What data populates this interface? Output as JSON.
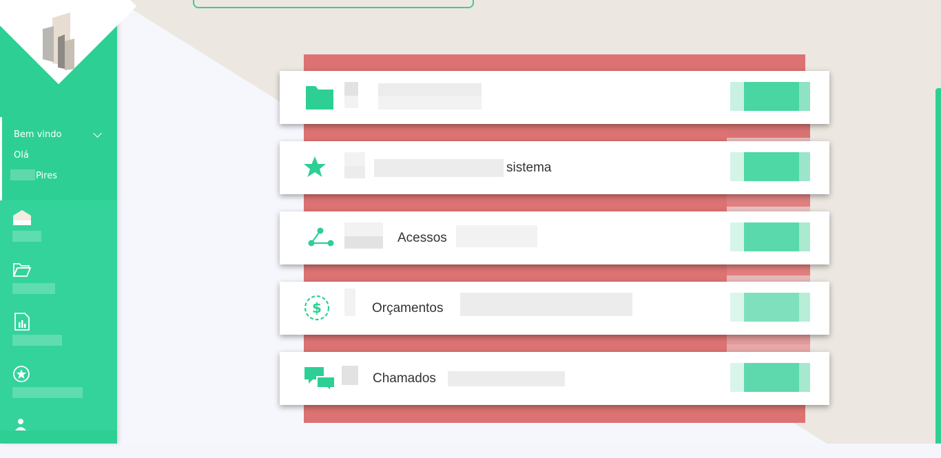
{
  "sidebar": {
    "welcome": {
      "title": "Bem vindo",
      "greeting": "Olá",
      "user_name": "Pires"
    },
    "nav_items": [
      {
        "icon": "home-icon"
      },
      {
        "icon": "folder-open-icon"
      },
      {
        "icon": "report-icon"
      },
      {
        "icon": "star-circle-icon"
      },
      {
        "icon": "users-icon"
      }
    ]
  },
  "cards": [
    {
      "icon": "folder-icon",
      "label": ""
    },
    {
      "icon": "star-icon",
      "label": "sistema"
    },
    {
      "icon": "share-nodes-icon",
      "label": "Acessos"
    },
    {
      "icon": "dollar-circle-icon",
      "label": "Orçamentos"
    },
    {
      "icon": "chat-icon",
      "label": "Chamados"
    }
  ],
  "colors": {
    "accent": "#2ecf94",
    "panel": "#dc7372",
    "background": "#ece7e0"
  }
}
